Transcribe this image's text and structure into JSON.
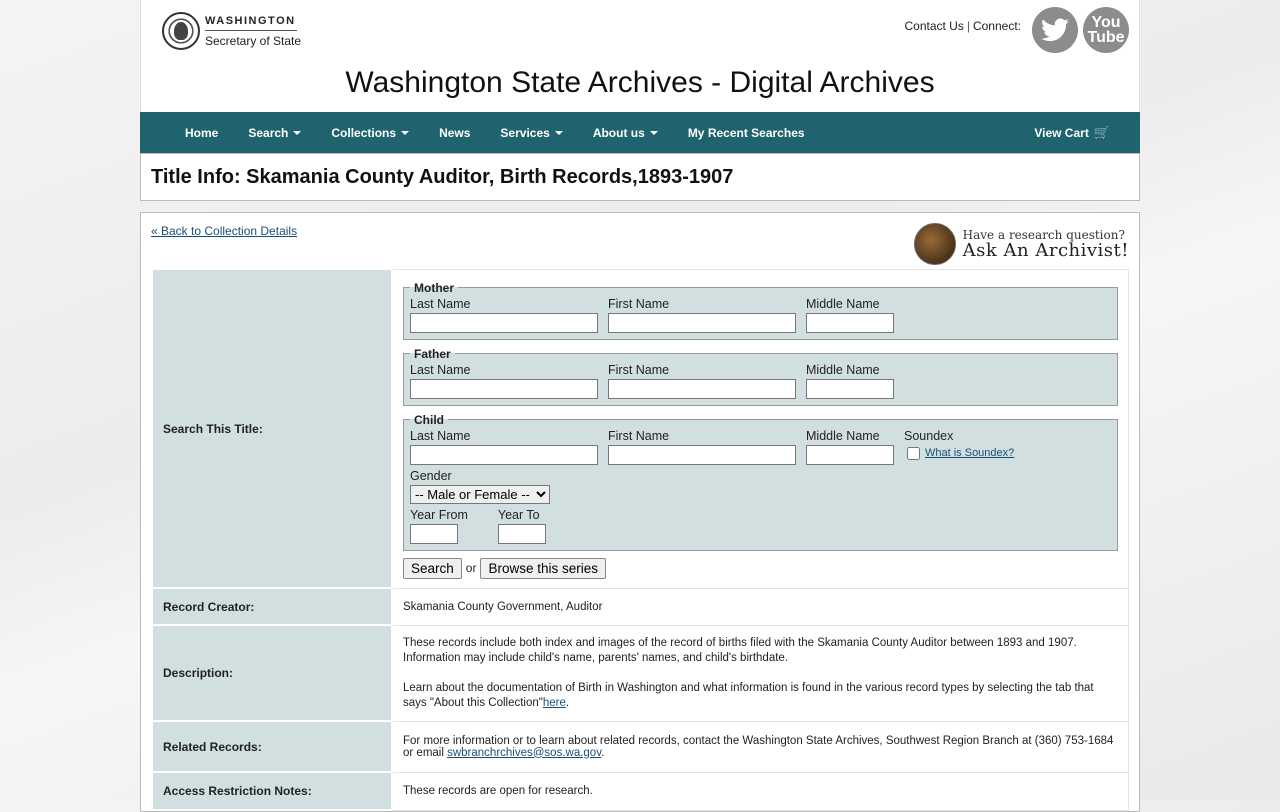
{
  "header": {
    "org_top": "WASHINGTON",
    "org_bottom": "Secretary of State",
    "contact_us": "Contact Us",
    "separator": "|",
    "connect": "Connect:",
    "youtube_top": "You",
    "youtube_bottom": "Tube",
    "site_title": "Washington State Archives - Digital Archives"
  },
  "nav": {
    "items": [
      {
        "label": "Home",
        "dropdown": false
      },
      {
        "label": "Search",
        "dropdown": true
      },
      {
        "label": "Collections",
        "dropdown": true
      },
      {
        "label": "News",
        "dropdown": false
      },
      {
        "label": "Services",
        "dropdown": true
      },
      {
        "label": "About us",
        "dropdown": true
      },
      {
        "label": "My Recent Searches",
        "dropdown": false
      }
    ],
    "cart_label": "View Cart",
    "cart_icon": "cart-icon"
  },
  "page_title": "Title Info: Skamania County Auditor, Birth Records,1893-1907",
  "back_link": "« Back to Collection Details",
  "ask": {
    "question": "Have a research question?",
    "main": "Ask An Archivist!"
  },
  "search": {
    "label": "Search This Title:",
    "mother": {
      "legend": "Mother",
      "last": "Last Name",
      "first": "First Name",
      "middle": "Middle Name"
    },
    "father": {
      "legend": "Father",
      "last": "Last Name",
      "first": "First Name",
      "middle": "Middle Name"
    },
    "child": {
      "legend": "Child",
      "last": "Last Name",
      "first": "First Name",
      "middle": "Middle Name",
      "soundex": "Soundex",
      "soundex_link": "What is Soundex?",
      "gender_label": "Gender",
      "gender_value": "-- Male or Female --",
      "year_from": "Year From",
      "year_to": "Year To"
    },
    "search_button": "Search",
    "or": "or",
    "browse_button": "Browse this series"
  },
  "rows": {
    "creator_label": "Record Creator:",
    "creator_value": "Skamania County Government, Auditor",
    "description_label": "Description:",
    "description_p1": "These records include both index and images of the record of births filed with the Skamania County Auditor between 1893 and 1907. Information may include child's name, parents' names, and child's birthdate.",
    "description_p2": "Learn about the documentation of Birth in Washington and what information is found in the various record types by selecting the tab that says \"About this Collection\"",
    "description_link": "here",
    "description_end": ".",
    "related_label": "Related Records:",
    "related_text": "For more information or to learn about related records, contact the Washington State Archives, Southwest Region Branch at (360) 753-1684 or email ",
    "related_email": "swbranchrchives@sos.wa.gov",
    "related_end": ".",
    "access_label": "Access Restriction Notes:",
    "access_value": "These records are open for research."
  }
}
